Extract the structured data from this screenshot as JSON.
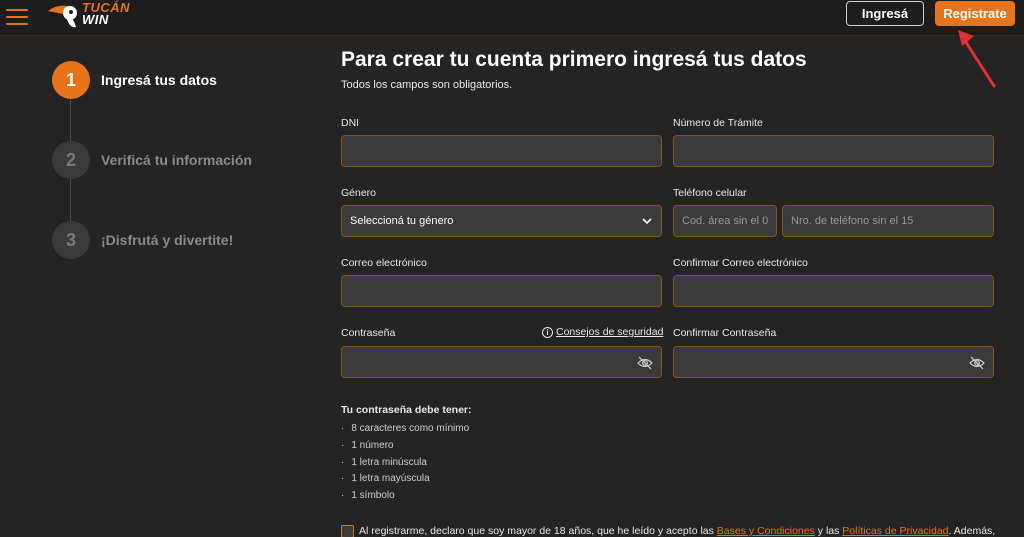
{
  "header": {
    "logo_line1": "TUCÁN",
    "logo_line2": "WIN",
    "login_label": "Ingresá",
    "register_label": "Registrate",
    "accent_color": "#e8731a"
  },
  "steps": [
    {
      "number": "1",
      "label": "Ingresá tus datos",
      "state": "active"
    },
    {
      "number": "2",
      "label": "Verificá tu información",
      "state": "inactive"
    },
    {
      "number": "3",
      "label": "¡Disfrutá y divertite!",
      "state": "inactive"
    }
  ],
  "form": {
    "title": "Para crear tu cuenta primero ingresá tus datos",
    "subtitle": "Todos los campos son obligatorios.",
    "dni": {
      "label": "DNI",
      "value": ""
    },
    "tramite": {
      "label": "Número de Trámite",
      "value": ""
    },
    "genero": {
      "label": "Género",
      "selected": "Seleccioná tu género"
    },
    "telefono": {
      "label": "Teléfono celular",
      "area_placeholder": "Cod. área sin el 0",
      "number_placeholder": "Nro. de teléfono sin el 15"
    },
    "email": {
      "label": "Correo electrónico",
      "value": ""
    },
    "email_confirm": {
      "label": "Confirmar Correo electrónico",
      "value": ""
    },
    "password": {
      "label": "Contraseña",
      "value": ""
    },
    "password_confirm": {
      "label": "Confirmar Contraseña",
      "value": ""
    },
    "security_tips": "Consejos de seguridad",
    "requirements_title": "Tu contraseña debe tener:",
    "requirements": [
      "8 caracteres como mínimo",
      "1 número",
      "1 letra minúscula",
      "1 letra mayúscula",
      "1 símbolo"
    ],
    "terms": {
      "prefix": "Al registrarme, declaro que soy mayor de 18 años, que he leído y acepto las ",
      "link1": "Bases y Condiciones",
      "middle": " y las ",
      "link2": "Políticas de Privacidad",
      "suffix": ". Además,"
    }
  }
}
